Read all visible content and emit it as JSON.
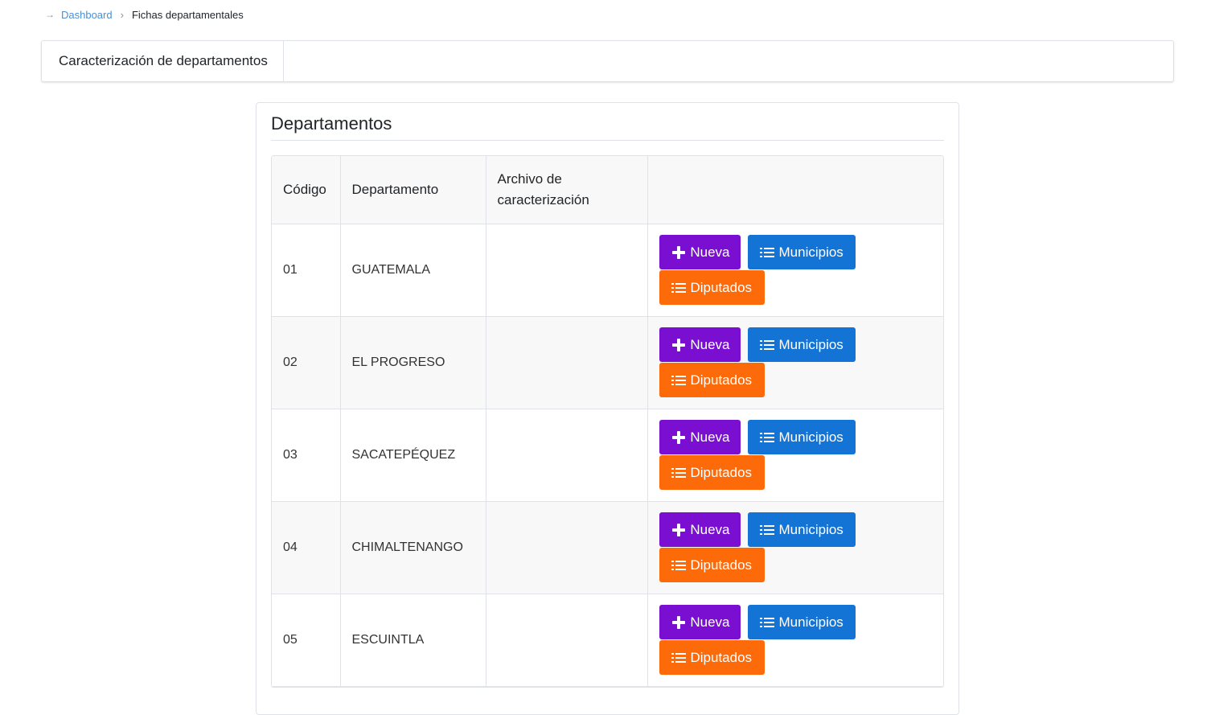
{
  "breadcrumb": {
    "home_label": "Dashboard",
    "current_label": "Fichas departamentales"
  },
  "tabs": [
    {
      "label": "Caracterización de departamentos"
    }
  ],
  "panel": {
    "title": "Departamentos"
  },
  "table": {
    "headers": [
      "Código",
      "Departamento",
      "Archivo de caracterización",
      ""
    ],
    "rows": [
      {
        "code": "01",
        "name": "GUATEMALA",
        "file": ""
      },
      {
        "code": "02",
        "name": "EL PROGRESO",
        "file": ""
      },
      {
        "code": "03",
        "name": "SACATEPÉQUEZ",
        "file": ""
      },
      {
        "code": "04",
        "name": "CHIMALTENANGO",
        "file": ""
      },
      {
        "code": "05",
        "name": "ESCUINTLA",
        "file": ""
      }
    ]
  },
  "actions": {
    "new_label": "Nueva",
    "municipios_label": "Municipios",
    "diputados_label": "Diputados",
    "new_icon": "plus-icon",
    "list_icon": "list-icon"
  },
  "colors": {
    "new_button": "#7a0fd1",
    "municipios_button": "#1474d6",
    "diputados_button": "#fd6a0a",
    "link": "#4a8fd6"
  }
}
